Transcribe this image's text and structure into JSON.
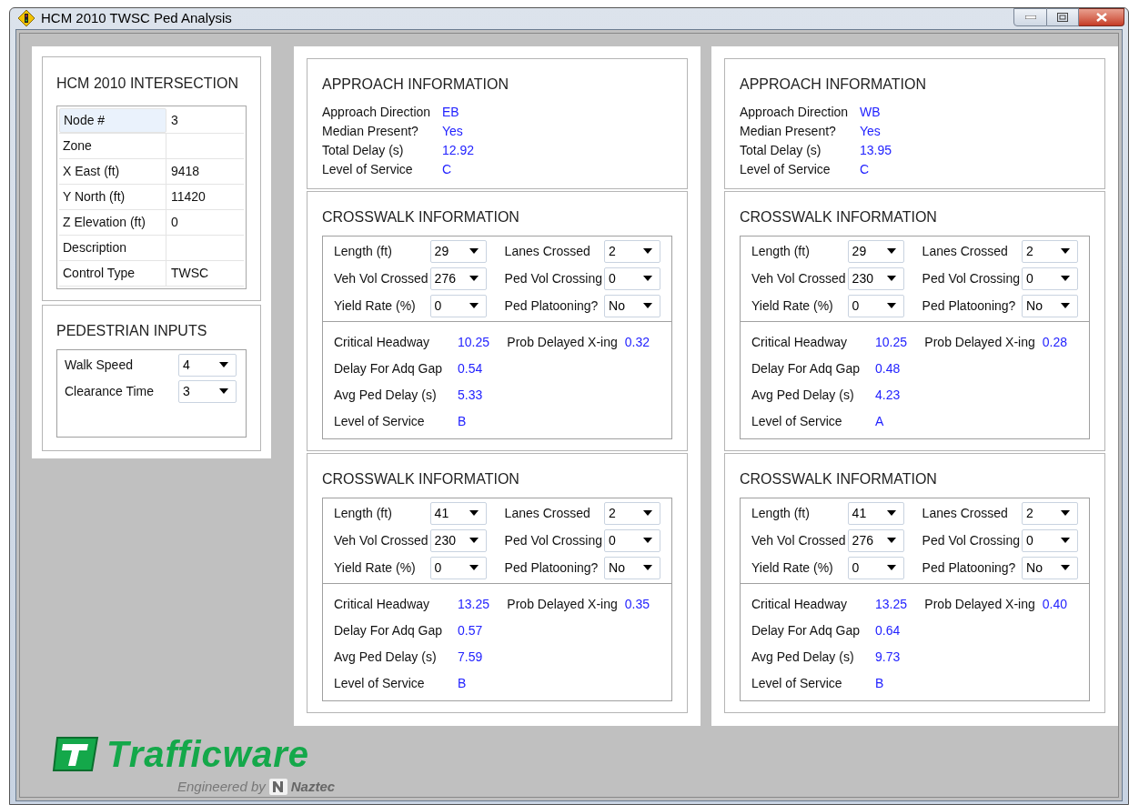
{
  "window": {
    "title": "HCM 2010 TWSC Ped Analysis"
  },
  "intersection": {
    "title": "HCM 2010 INTERSECTION",
    "rows": [
      {
        "label": "Node #",
        "value": "3",
        "selected": true
      },
      {
        "label": "Zone",
        "selected": false
      },
      {
        "label": "X East (ft)",
        "value": "9418",
        "selected": false
      },
      {
        "label": "Y North (ft)",
        "value": "11420",
        "selected": false
      },
      {
        "label": "Z Elevation (ft)",
        "value": "0",
        "selected": false
      },
      {
        "label": "Description",
        "selected": false
      },
      {
        "label": "Control Type",
        "value": "TWSC",
        "selected": false
      }
    ]
  },
  "pedestrian_inputs": {
    "title": "PEDESTRIAN INPUTS",
    "fields": [
      {
        "label": "Walk Speed",
        "value": "4"
      },
      {
        "label": "Clearance Time",
        "value": "3"
      }
    ]
  },
  "approaches": [
    {
      "title": "APPROACH INFORMATION",
      "info": [
        {
          "label": "Approach Direction",
          "value": "EB"
        },
        {
          "label": "Median Present?",
          "value": "Yes"
        },
        {
          "label": "Total Delay (s)",
          "value": "12.92"
        },
        {
          "label": "Level of Service",
          "value": "C"
        }
      ],
      "crosswalks": [
        {
          "title": "CROSSWALK INFORMATION",
          "inputs": [
            {
              "label": "Length (ft)",
              "value": "29"
            },
            {
              "label": "Lanes Crossed",
              "value": "2"
            },
            {
              "label": "Veh Vol Crossed",
              "value": "276"
            },
            {
              "label": "Ped Vol Crossing",
              "value": "0"
            },
            {
              "label": "Yield Rate (%)",
              "value": "0"
            },
            {
              "label": "Ped Platooning?",
              "value": "No"
            }
          ],
          "results": [
            {
              "label": "Critical Headway",
              "value": "10.25"
            },
            {
              "label": "Delay For Adq Gap",
              "value": "0.54"
            },
            {
              "label": "Avg Ped Delay (s)",
              "value": "5.33"
            },
            {
              "label": "Level of Service",
              "value": "B"
            }
          ],
          "side_result": {
            "label": "Prob Delayed X-ing",
            "value": "0.32"
          }
        },
        {
          "title": "CROSSWALK INFORMATION",
          "inputs": [
            {
              "label": "Length (ft)",
              "value": "41"
            },
            {
              "label": "Lanes Crossed",
              "value": "2"
            },
            {
              "label": "Veh Vol Crossed",
              "value": "230"
            },
            {
              "label": "Ped Vol Crossing",
              "value": "0"
            },
            {
              "label": "Yield Rate (%)",
              "value": "0"
            },
            {
              "label": "Ped Platooning?",
              "value": "No"
            }
          ],
          "results": [
            {
              "label": "Critical Headway",
              "value": "13.25"
            },
            {
              "label": "Delay For Adq Gap",
              "value": "0.57"
            },
            {
              "label": "Avg Ped Delay (s)",
              "value": "7.59"
            },
            {
              "label": "Level of Service",
              "value": "B"
            }
          ],
          "side_result": {
            "label": "Prob Delayed X-ing",
            "value": "0.35"
          }
        }
      ]
    },
    {
      "title": "APPROACH INFORMATION",
      "info": [
        {
          "label": "Approach Direction",
          "value": "WB"
        },
        {
          "label": "Median Present?",
          "value": "Yes"
        },
        {
          "label": "Total Delay (s)",
          "value": "13.95"
        },
        {
          "label": "Level of Service",
          "value": "C"
        }
      ],
      "crosswalks": [
        {
          "title": "CROSSWALK INFORMATION",
          "inputs": [
            {
              "label": "Length (ft)",
              "value": "29"
            },
            {
              "label": "Lanes Crossed",
              "value": "2"
            },
            {
              "label": "Veh Vol Crossed",
              "value": "230"
            },
            {
              "label": "Ped Vol Crossing",
              "value": "0"
            },
            {
              "label": "Yield Rate (%)",
              "value": "0"
            },
            {
              "label": "Ped Platooning?",
              "value": "No"
            }
          ],
          "results": [
            {
              "label": "Critical Headway",
              "value": "10.25"
            },
            {
              "label": "Delay For Adq Gap",
              "value": "0.48"
            },
            {
              "label": "Avg Ped Delay (s)",
              "value": "4.23"
            },
            {
              "label": "Level of Service",
              "value": "A"
            }
          ],
          "side_result": {
            "label": "Prob Delayed X-ing",
            "value": "0.28"
          }
        },
        {
          "title": "CROSSWALK INFORMATION",
          "inputs": [
            {
              "label": "Length (ft)",
              "value": "41"
            },
            {
              "label": "Lanes Crossed",
              "value": "2"
            },
            {
              "label": "Veh Vol Crossed",
              "value": "276"
            },
            {
              "label": "Ped Vol Crossing",
              "value": "0"
            },
            {
              "label": "Yield Rate (%)",
              "value": "0"
            },
            {
              "label": "Ped Platooning?",
              "value": "No"
            }
          ],
          "results": [
            {
              "label": "Critical Headway",
              "value": "13.25"
            },
            {
              "label": "Delay For Adq Gap",
              "value": "0.64"
            },
            {
              "label": "Avg Ped Delay (s)",
              "value": "9.73"
            },
            {
              "label": "Level of Service",
              "value": "B"
            }
          ],
          "side_result": {
            "label": "Prob Delayed X-ing",
            "value": "0.40"
          }
        }
      ]
    }
  ],
  "logo": {
    "brand": "Trafficware",
    "tagline": "Engineered by",
    "partner": "Naztec"
  }
}
